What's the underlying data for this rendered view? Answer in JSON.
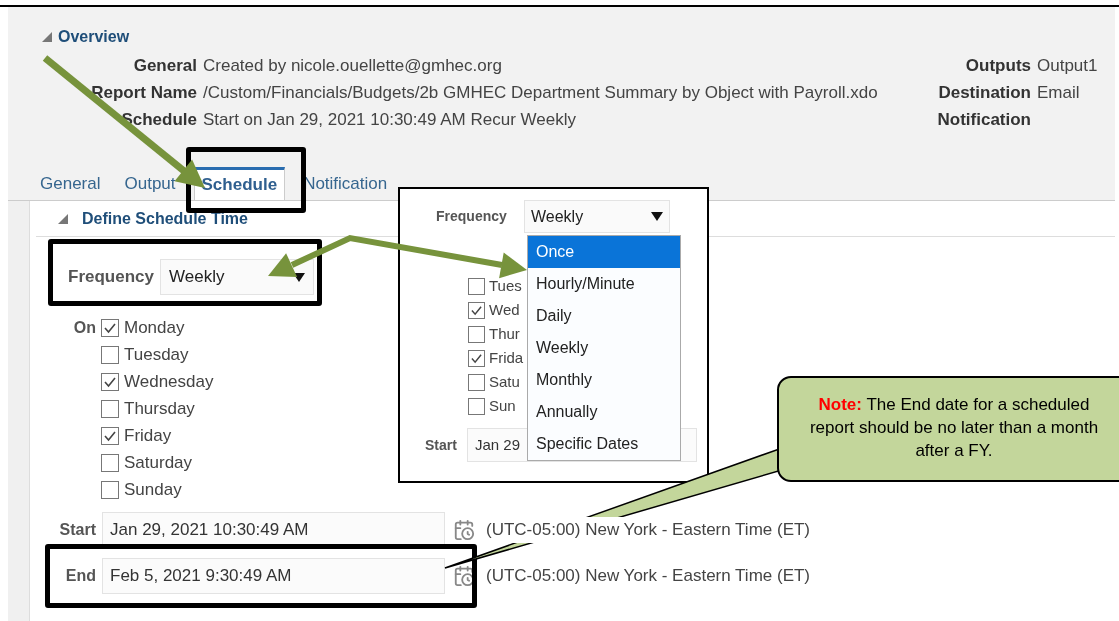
{
  "overview": {
    "title": "Overview",
    "left_fields": [
      {
        "label": "General",
        "value": "Created by nicole.ouellette@gmhec.org"
      },
      {
        "label": "Report Name",
        "value": "/Custom/Financials/Budgets/2b GMHEC Department Summary by Object with Payroll.xdo"
      },
      {
        "label": "Schedule",
        "value": "Start on Jan 29, 2021 10:30:49 AM Recur Weekly"
      }
    ],
    "right_fields": [
      {
        "label": "Outputs",
        "value": "Output1"
      },
      {
        "label": "Destination",
        "value": "Email"
      },
      {
        "label": "Notification"
      }
    ]
  },
  "tabs": [
    {
      "label": "General",
      "selected": false
    },
    {
      "label": "Output",
      "selected": false
    },
    {
      "label": "Schedule",
      "selected": true
    },
    {
      "label": "Notification",
      "selected": false
    }
  ],
  "schedule_section": {
    "title": "Define Schedule Time",
    "frequency": {
      "label": "Frequency",
      "value": "Weekly"
    },
    "on_label": "On",
    "days": [
      {
        "label": "Monday",
        "checked": true
      },
      {
        "label": "Tuesday",
        "checked": false
      },
      {
        "label": "Wednesday",
        "checked": true
      },
      {
        "label": "Thursday",
        "checked": false
      },
      {
        "label": "Friday",
        "checked": true
      },
      {
        "label": "Saturday",
        "checked": false
      },
      {
        "label": "Sunday",
        "checked": false
      }
    ],
    "start": {
      "label": "Start",
      "value": "Jan 29, 2021 10:30:49 AM",
      "timezone": "(UTC-05:00) New York - Eastern Time (ET)"
    },
    "end": {
      "label": "End",
      "value": "Feb 5, 2021 9:30:49 AM",
      "timezone": "(UTC-05:00) New York - Eastern Time (ET)"
    }
  },
  "inset_screenshot": {
    "frequency": {
      "label": "Frequency",
      "value": "Weekly"
    },
    "days": [
      {
        "label": "Tues",
        "checked": false
      },
      {
        "label": "Wed",
        "checked": true
      },
      {
        "label": "Thur",
        "checked": false
      },
      {
        "label": "Frida",
        "checked": true
      },
      {
        "label": "Satu",
        "checked": false
      },
      {
        "label": "Sun",
        "checked": false
      }
    ],
    "start": {
      "label": "Start",
      "value": "Jan 29"
    },
    "dropdown_options": [
      {
        "label": "Once",
        "selected": true
      },
      {
        "label": "Hourly/Minute",
        "selected": false
      },
      {
        "label": "Daily",
        "selected": false
      },
      {
        "label": "Weekly",
        "selected": false
      },
      {
        "label": "Monthly",
        "selected": false
      },
      {
        "label": "Annually",
        "selected": false
      },
      {
        "label": "Specific Dates",
        "selected": false
      }
    ]
  },
  "callout": {
    "text": "**Note:** The End date for a scheduled report should be no later than a month after a FY."
  }
}
